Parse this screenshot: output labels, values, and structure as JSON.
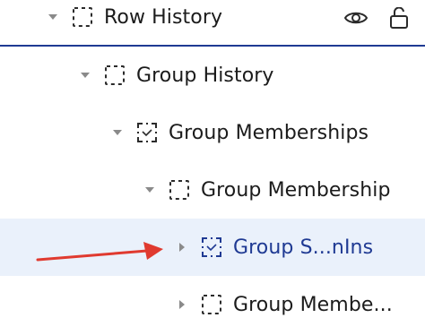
{
  "tree": {
    "rows": [
      {
        "label": "Row History",
        "caret": "expanded",
        "icon": "dashed-frame-icon"
      },
      {
        "label": "Group History",
        "caret": "expanded",
        "icon": "dashed-frame-icon"
      },
      {
        "label": "Group Memberships",
        "caret": "expanded",
        "icon": "dashed-corner-frame-icon"
      },
      {
        "label": "Group Membership",
        "caret": "expanded",
        "icon": "dashed-frame-icon"
      },
      {
        "label": "Group S...nIns",
        "caret": "collapsed",
        "icon": "dashed-corner-frame-icon",
        "selected": true
      },
      {
        "label": "Group Membe...",
        "caret": "collapsed",
        "icon": "dashed-frame-icon"
      }
    ],
    "header_icons": [
      "eye-icon",
      "unlock-icon"
    ]
  },
  "colors": {
    "selected_bg": "#eaf1fb",
    "selected_text": "#1f3a93",
    "divider": "#1f3a93",
    "caret": "#8a8a8a",
    "arrow": "#e03a2f"
  },
  "annotation": {
    "arrow": "red-arrow-pointer"
  }
}
